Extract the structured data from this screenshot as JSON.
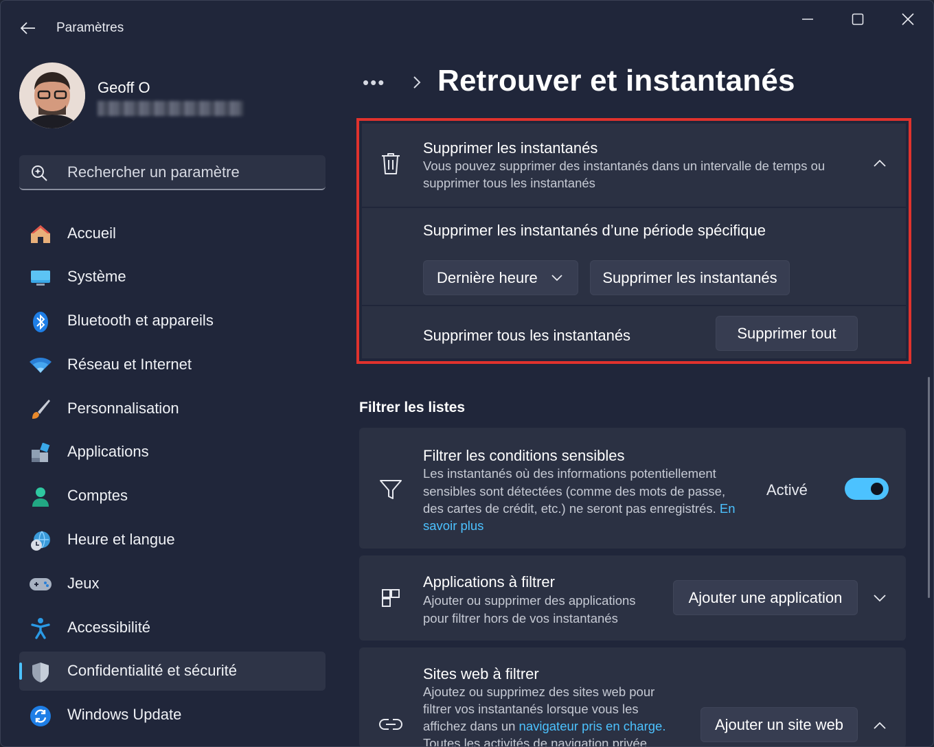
{
  "window": {
    "title": "Paramètres"
  },
  "user": {
    "name": "Geoff O"
  },
  "search": {
    "placeholder": "Rechercher un paramètre"
  },
  "nav": {
    "items": [
      {
        "label": "Accueil",
        "icon": "home-icon"
      },
      {
        "label": "Système",
        "icon": "monitor-icon"
      },
      {
        "label": "Bluetooth et appareils",
        "icon": "bluetooth-icon"
      },
      {
        "label": "Réseau et Internet",
        "icon": "wifi-icon"
      },
      {
        "label": "Personnalisation",
        "icon": "brush-icon"
      },
      {
        "label": "Applications",
        "icon": "apps-icon"
      },
      {
        "label": "Comptes",
        "icon": "person-icon"
      },
      {
        "label": "Heure et langue",
        "icon": "globe-clock-icon"
      },
      {
        "label": "Jeux",
        "icon": "gamepad-icon"
      },
      {
        "label": "Accessibilité",
        "icon": "accessibility-icon"
      },
      {
        "label": "Confidentialité et sécurité",
        "icon": "shield-icon",
        "active": true
      },
      {
        "label": "Windows Update",
        "icon": "update-icon"
      }
    ]
  },
  "breadcrumb": {
    "overflow": "•••"
  },
  "page": {
    "title": "Retrouver et instantanés"
  },
  "delete_card": {
    "title": "Supprimer les instantanés",
    "desc_line1": "Vous pouvez supprimer des instantanés dans un intervalle de temps ou",
    "desc_line2": "supprimer tous les instantanés",
    "period_label": "Supprimer les instantanés d’une période spécifique",
    "period_select": "Dernière heure",
    "period_button": "Supprimer les instantanés",
    "all_label": "Supprimer tous les instantanés",
    "all_button": "Supprimer tout"
  },
  "filter_section": {
    "title": "Filtrer les listes"
  },
  "sensitive_card": {
    "title": "Filtrer les conditions sensibles",
    "desc_line1": "Les instantanés où des informations potentiellement",
    "desc_line2": "sensibles sont détectées (comme des mots de passe,",
    "desc_line3": "des cartes de crédit, etc.) ne seront pas enregistrés.",
    "link_part1": "En",
    "link_part2": "savoir plus",
    "state": "Activé",
    "toggle_on": true
  },
  "apps_card": {
    "title": "Applications à filtrer",
    "desc_line1": "Ajouter ou supprimer des applications",
    "desc_line2": "pour filtrer hors de vos instantanés",
    "button": "Ajouter une application"
  },
  "sites_card": {
    "title": "Sites web à filtrer",
    "desc_line1": "Ajoutez ou supprimez des sites web pour",
    "desc_line2": "filtrer vos instantanés lorsque vous les",
    "desc_line3": "affichez dans un",
    "link": "navigateur pris en charge.",
    "desc_line4": "Toutes les activités de navigation privée",
    "button": "Ajouter un site web"
  },
  "colors": {
    "accent": "#4cc2ff",
    "highlight": "#e0322d",
    "background": "#20263a",
    "card": "#2b3143"
  }
}
